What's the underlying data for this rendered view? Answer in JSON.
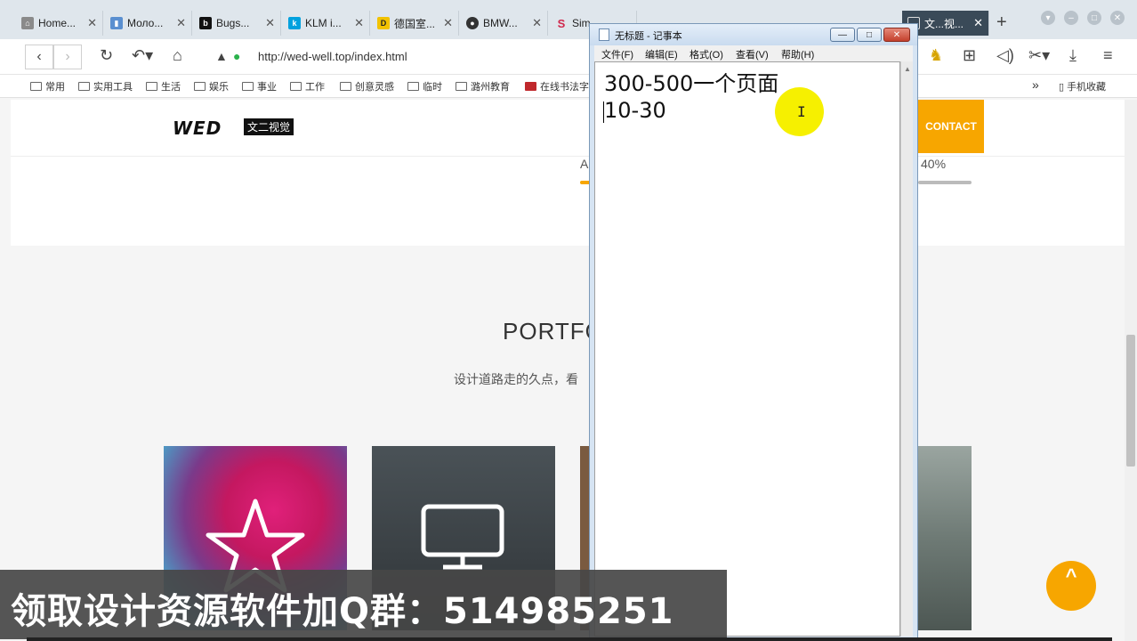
{
  "browser": {
    "tabs": [
      {
        "title": "Home...",
        "favicon": "home-favicon",
        "color": "#8a8a8a"
      },
      {
        "title": "Моло...",
        "favicon": "chart-favicon",
        "color": "#5a8fd0"
      },
      {
        "title": "Bugs...",
        "favicon": "bugs-favicon",
        "color": "#111111"
      },
      {
        "title": "KLM i...",
        "favicon": "klm-favicon",
        "color": "#00a1de"
      },
      {
        "title": "德国室...",
        "favicon": "d-favicon",
        "color": "#f2c200"
      },
      {
        "title": "BMW...",
        "favicon": "bmw-favicon",
        "color": "#333333"
      },
      {
        "title": "Sim",
        "favicon": "s-favicon",
        "color": "#d0284c"
      },
      {
        "title": "文...视...",
        "favicon": "page-favicon",
        "color": "#cccccc",
        "active": true
      }
    ],
    "url": "http://wed-well.top/index.html",
    "bookmarks": [
      "常用",
      "实用工具",
      "生活",
      "娱乐",
      "事业",
      "工作",
      "创意灵感",
      "临时",
      "潞州教育",
      "在线书法字"
    ],
    "mobile_bookmarks": "手机收藏"
  },
  "site": {
    "logo_text": "WED",
    "logo_cn": "文二视觉",
    "contact": "CONTACT",
    "skill_left_label": "A",
    "skill_right_percent": "40%",
    "skill_right_value": 40,
    "portfolio_title": "PORTFO",
    "portfolio_subtitle": "设计道路走的久点，看",
    "scroll_top": "^"
  },
  "notepad": {
    "title": "无标题 - 记事本",
    "menu": [
      "文件(F)",
      "编辑(E)",
      "格式(O)",
      "查看(V)",
      "帮助(H)"
    ],
    "lines": [
      "300-500一个页面",
      "10-30"
    ],
    "controls": {
      "minimize": "—",
      "maximize": "□",
      "close": "✕"
    }
  },
  "overlay": {
    "banner": "领取设计资源软件加Q群：514985251"
  },
  "colors": {
    "accent": "#f7a600",
    "tab_active": "#3a4a58"
  }
}
